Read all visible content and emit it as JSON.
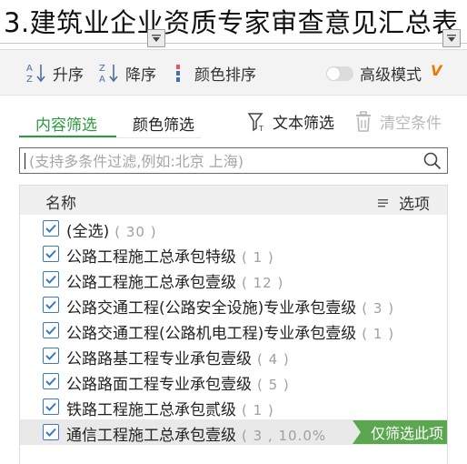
{
  "sheet": {
    "title": "3.建筑业企业资质专家审查意见汇总表"
  },
  "toolbar": {
    "sort_asc": "升序",
    "sort_desc": "降序",
    "color_sort": "颜色排序",
    "advanced_mode": "高级模式",
    "vip_badge": "V"
  },
  "tabs": {
    "content_filter": "内容筛选",
    "color_filter": "颜色筛选",
    "text_filter": "文本筛选",
    "clear_conditions": "清空条件"
  },
  "search": {
    "placeholder": "(支持多条件过滤,例如:北京 上海)",
    "value": ""
  },
  "list": {
    "header_name": "名称",
    "header_options": "选项",
    "items": [
      {
        "label": "(全选)",
        "count": "( 30 )",
        "checked": true
      },
      {
        "label": "公路工程施工总承包特级",
        "count": "( 1 )",
        "checked": true
      },
      {
        "label": "公路工程施工总承包壹级",
        "count": "( 12 )",
        "checked": true
      },
      {
        "label": "公路交通工程(公路安全设施)专业承包壹级",
        "count": "( 3 )",
        "checked": true
      },
      {
        "label": "公路交通工程(公路机电工程)专业承包壹级",
        "count": "( 1 )",
        "checked": true
      },
      {
        "label": "公路路基工程专业承包壹级",
        "count": "( 4 )",
        "checked": true
      },
      {
        "label": "公路路面工程专业承包壹级",
        "count": "( 5 )",
        "checked": true
      },
      {
        "label": "铁路工程施工总承包贰级",
        "count": "( 1 )",
        "checked": true
      },
      {
        "label": "通信工程施工总承包壹级",
        "count": "( 3 , 10.0%",
        "checked": true,
        "hover": true
      }
    ],
    "only_filter_label": "仅筛选此项"
  },
  "colors": {
    "accent_green": "#2a9b3e",
    "checkbox_blue": "#3a78c8",
    "only_button_green": "#5aa74f",
    "vip_orange": "#f07800"
  }
}
